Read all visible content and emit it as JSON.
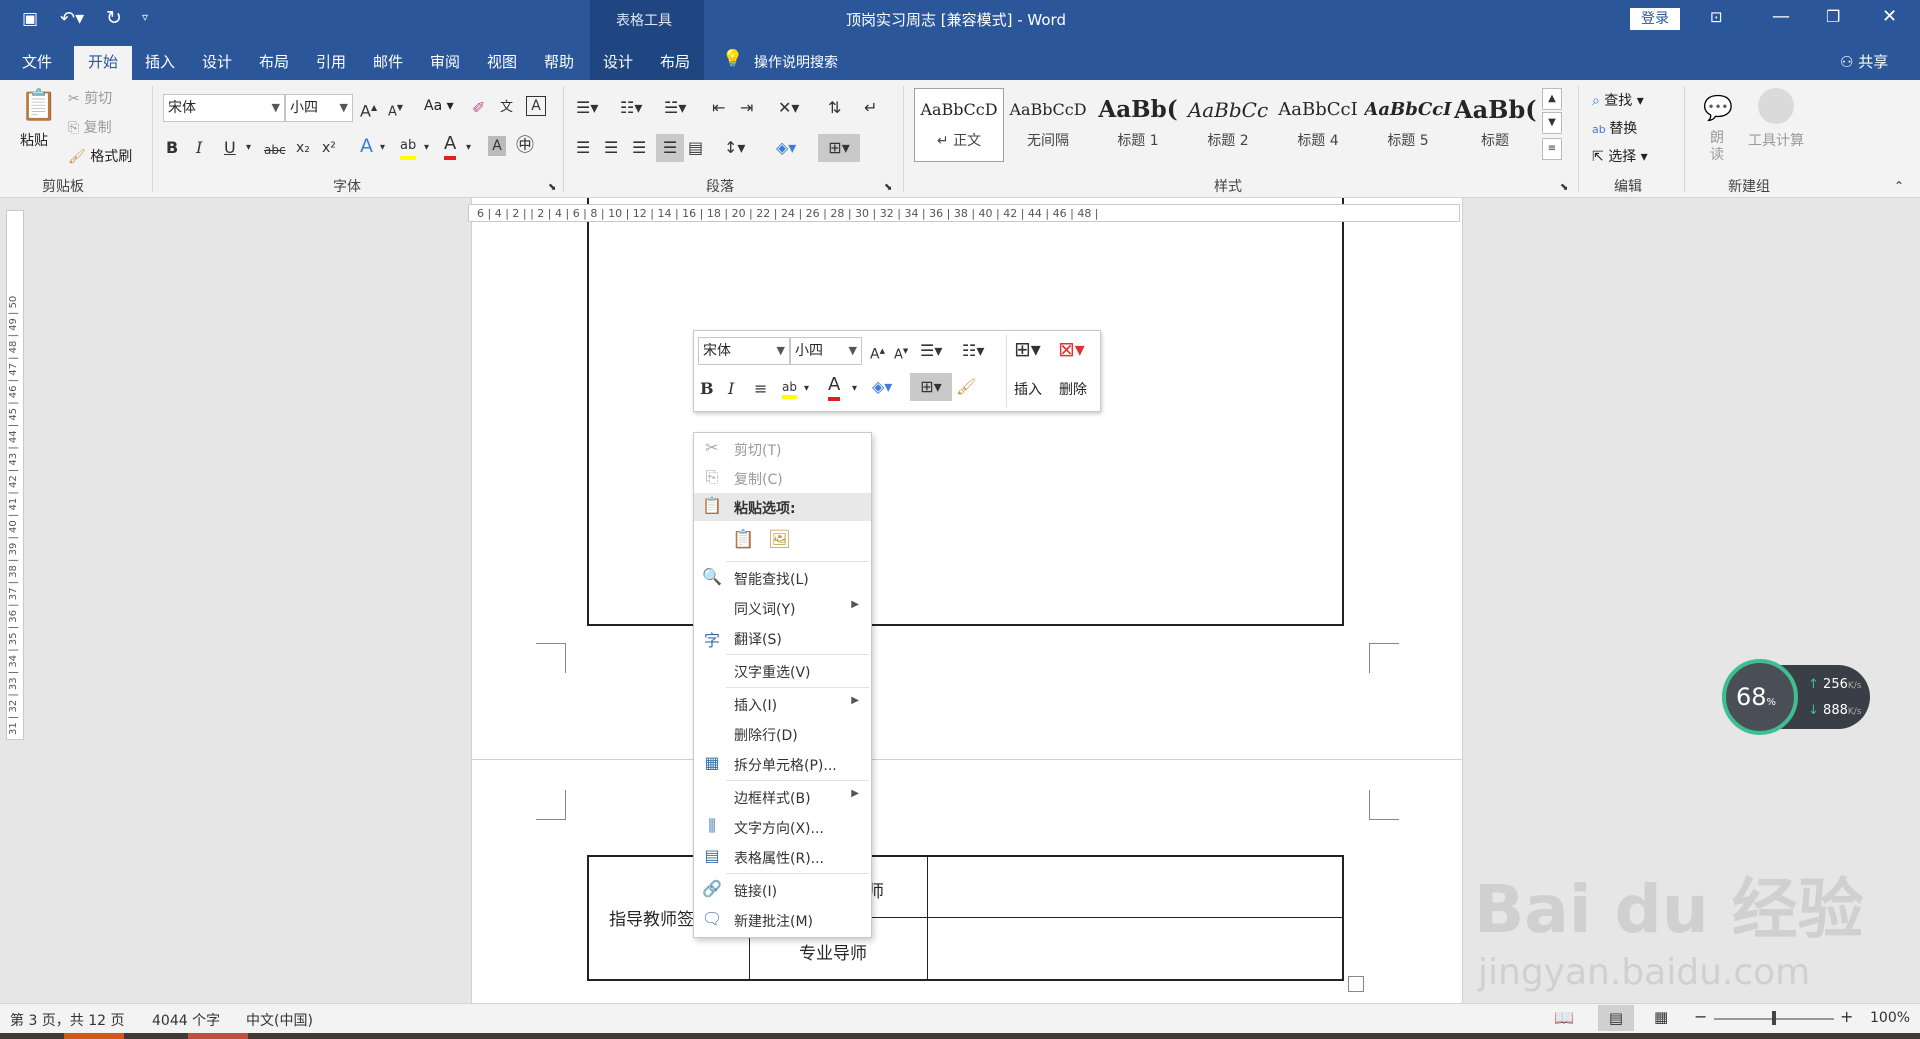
{
  "qat": {
    "save_icon": "save-icon",
    "undo_icon": "undo-icon",
    "redo_icon": "redo-icon",
    "customize_icon": "customize-icon"
  },
  "titlebar": {
    "context_label": "表格工具",
    "title": "顶岗实习周志 [兼容模式]  -  Word",
    "login": "登录"
  },
  "tabs": [
    "文件",
    "开始",
    "插入",
    "设计",
    "布局",
    "引用",
    "邮件",
    "审阅",
    "视图",
    "帮助",
    "设计",
    "布局"
  ],
  "active_tab": "开始",
  "tell_me": "操作说明搜索",
  "share": "共享",
  "clipboard": {
    "paste": "粘贴",
    "cut": "剪切",
    "copy": "复制",
    "format_painter": "格式刷",
    "group": "剪贴板"
  },
  "font": {
    "name": "宋体",
    "size": "小四",
    "group": "字体",
    "bold": "B",
    "italic": "I",
    "underline": "U",
    "strike": "abc",
    "sub": "x₂",
    "sup": "x²",
    "aa": "Aa"
  },
  "paragraph": {
    "group": "段落"
  },
  "styles": {
    "group": "样式",
    "items": [
      {
        "preview": "AaBbCcD",
        "label": "↵ 正文"
      },
      {
        "preview": "AaBbCcD",
        "label": "无间隔"
      },
      {
        "preview": "AaBb(",
        "label": "标题 1"
      },
      {
        "preview": "AaBbCc",
        "label": "标题 2"
      },
      {
        "preview": "AaBbCcI",
        "label": "标题 4"
      },
      {
        "preview": "AaBbCcI",
        "label": "标题 5"
      },
      {
        "preview": "AaBb(",
        "label": "标题"
      }
    ]
  },
  "editing": {
    "group": "编辑",
    "find": "查找",
    "replace": "替换",
    "select": "选择"
  },
  "newgroup": {
    "group": "新建组",
    "read": "朗读",
    "tool_calc": "工具计算"
  },
  "ruler": {
    "marks": "6 | 4 | 2 |  | 2 | 4 | 6 | 8 | 10 | 12 | 14 | 16 | 18 | 20 | 22 | 24 | 26 | 28 | 30 | 32 | 34 | 36 | 38 | 40 | 42 | 44 | 46 | 48 |",
    "vmarks": "31 | 32 | 33 | 34 | 35 | 36 | 37 | 38 | 39 | 40 | 41 | 42 | 43 | 44 | 45 | 46 | 47 | 48 | 49 | 50"
  },
  "mini_toolbar": {
    "font": "宋体",
    "size": "小四",
    "insert": "插入",
    "delete": "删除",
    "bold": "B",
    "italic": "I"
  },
  "context_menu": {
    "items": [
      {
        "label": "剪切(T)",
        "icon": "scissors-icon",
        "disabled": true
      },
      {
        "label": "复制(C)",
        "icon": "copy-icon",
        "disabled": true
      },
      {
        "label": "粘贴选项:",
        "icon": "paste-icon",
        "bold": true
      },
      {
        "label": "智能查找(L)",
        "icon": "smart-lookup-icon"
      },
      {
        "label": "同义词(Y)",
        "submenu": true
      },
      {
        "label": "翻译(S)",
        "icon": "translate-icon"
      },
      {
        "label": "汉字重选(V)"
      },
      {
        "label": "插入(I)",
        "submenu": true
      },
      {
        "label": "删除行(D)"
      },
      {
        "label": "拆分单元格(P)...",
        "icon": "split-cells-icon"
      },
      {
        "label": "边框样式(B)",
        "submenu": true
      },
      {
        "label": "文字方向(X)...",
        "icon": "text-direction-icon"
      },
      {
        "label": "表格属性(R)...",
        "icon": "table-properties-icon"
      },
      {
        "label": "链接(I)",
        "icon": "link-icon"
      },
      {
        "label": "新建批注(M)",
        "icon": "new-comment-icon"
      }
    ]
  },
  "table": {
    "cell_left": "指导教师签",
    "cell_mid_top": "师",
    "cell_mid_bottom": "专业导师"
  },
  "netwidget": {
    "percent": "68",
    "percent_unit": "%",
    "up": "256",
    "up_unit": "K/s",
    "down": "888",
    "down_unit": "K/s"
  },
  "watermark": {
    "logo": "Bai du 经验",
    "url": "jingyan.baidu.com"
  },
  "status": {
    "page": "第 3 页，共 12 页",
    "words": "4044 个字",
    "lang": "中文(中国)",
    "zoom": "100%"
  },
  "colors": {
    "ribbon_blue": "#2b579a",
    "highlight": "#ffff00",
    "font_red": "#e02020"
  }
}
